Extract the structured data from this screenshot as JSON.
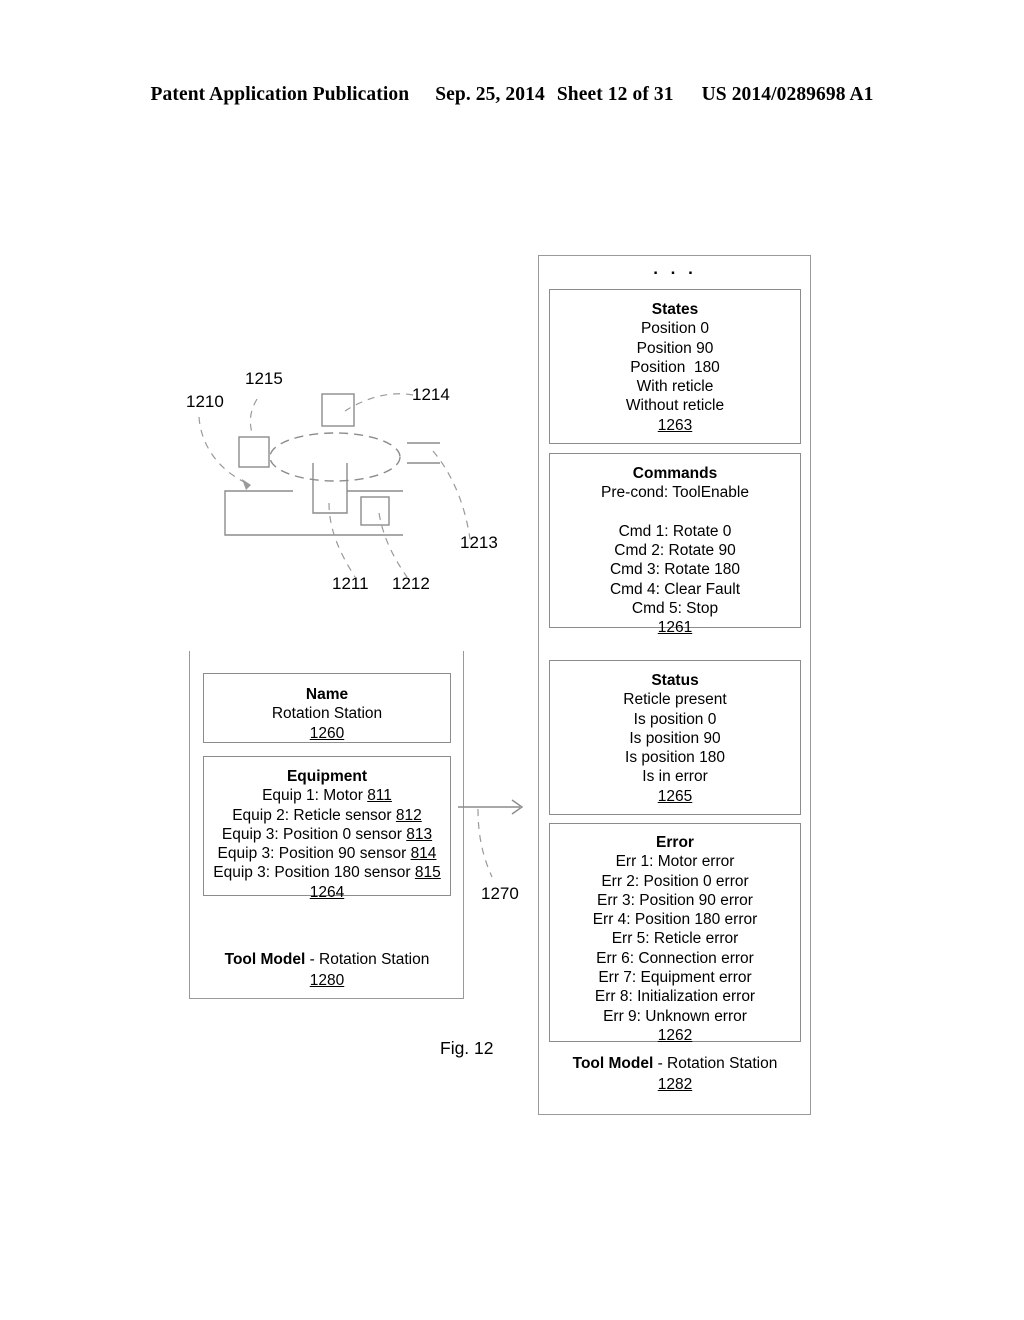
{
  "header": {
    "publication": "Patent Application Publication",
    "date": "Sep. 25, 2014",
    "sheet": "Sheet 12 of 31",
    "patent_number": "US 2014/0289698 A1"
  },
  "figure": {
    "caption": "Fig. 12",
    "ellipsis": ". . .",
    "connector_ref": "1270",
    "diagram_refs": {
      "station": "1210",
      "motor": "1211",
      "sensor_a": "1212",
      "sensor_b": "1213",
      "sensor_c": "1214",
      "sensor_d": "1215"
    }
  },
  "left_panel": {
    "name_box": {
      "title": "Name",
      "lines": [
        "Rotation Station"
      ],
      "ref": "1260"
    },
    "equipment_box": {
      "title": "Equipment",
      "items": [
        {
          "text": "Equip 1: Motor ",
          "ref": "811"
        },
        {
          "text": "Equip 2: Reticle sensor ",
          "ref": "812"
        },
        {
          "text": "Equip 3: Position 0 sensor ",
          "ref": "813"
        },
        {
          "text": "Equip 3: Position 90 sensor ",
          "ref": "814"
        },
        {
          "text": "Equip 3: Position 180 sensor ",
          "ref": "815"
        }
      ],
      "ref": "1264"
    },
    "footer": {
      "label_bold": "Tool Model",
      "label_rest": " - Rotation Station",
      "ref": "1280"
    }
  },
  "right_panel": {
    "states_box": {
      "title": "States",
      "lines": [
        "Position 0",
        "Position 90",
        "Position  180",
        "With reticle",
        "Without reticle"
      ],
      "ref": "1263"
    },
    "commands_box": {
      "title": "Commands",
      "precondition": "Pre-cond: ToolEnable",
      "lines": [
        "Cmd 1: Rotate 0",
        "Cmd 2: Rotate 90",
        "Cmd 3: Rotate 180",
        "Cmd 4: Clear Fault",
        "Cmd 5: Stop"
      ],
      "ref": "1261"
    },
    "status_box": {
      "title": "Status",
      "lines": [
        "Reticle present",
        "Is position 0",
        "Is position 90",
        "Is position 180",
        "Is in error"
      ],
      "ref": "1265"
    },
    "error_box": {
      "title": "Error",
      "lines": [
        "Err 1: Motor error",
        "Err 2: Position 0 error",
        "Err 3: Position 90 error",
        "Err 4: Position 180 error",
        "Err 5: Reticle error",
        "Err 6: Connection error",
        "Err 7: Equipment error",
        "Err 8: Initialization error",
        "Err 9: Unknown error"
      ],
      "ref": "1262"
    },
    "footer": {
      "label_bold": "Tool Model",
      "label_rest": " - Rotation Station",
      "ref": "1282"
    }
  },
  "colors": {
    "line": "#8c8c8c",
    "text": "#000000",
    "background": "#ffffff"
  }
}
